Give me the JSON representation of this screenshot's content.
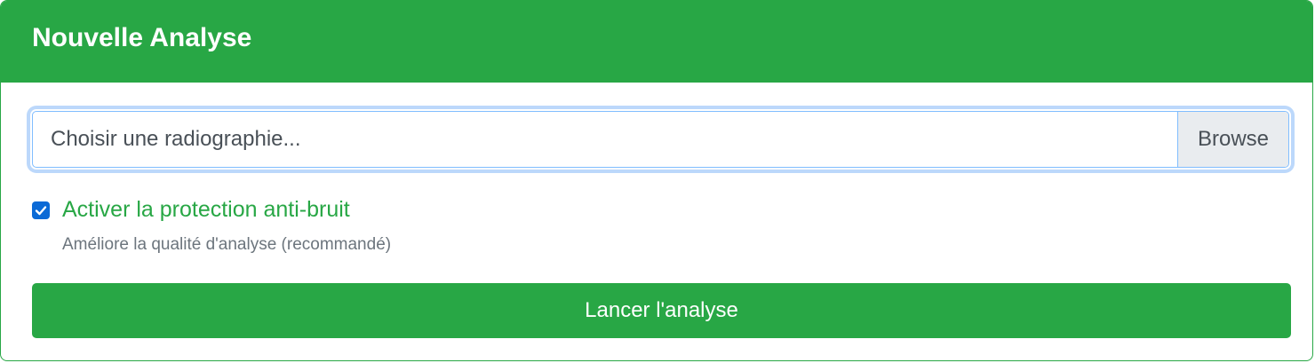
{
  "header": {
    "title": "Nouvelle Analyse"
  },
  "file_input": {
    "placeholder": "Choisir une radiographie...",
    "browse_label": "Browse"
  },
  "noise_protection": {
    "checked": true,
    "label": "Activer la protection anti-bruit",
    "hint": "Améliore la qualité d'analyse (recommandé)"
  },
  "submit": {
    "label": "Lancer l'analyse"
  },
  "icons": {
    "checkbox": "checkmark-icon"
  },
  "colors": {
    "accent": "#28a745",
    "checkbox": "#0b6ad6",
    "focus_ring": "#bcd8fb",
    "muted_text": "#6c757d"
  }
}
